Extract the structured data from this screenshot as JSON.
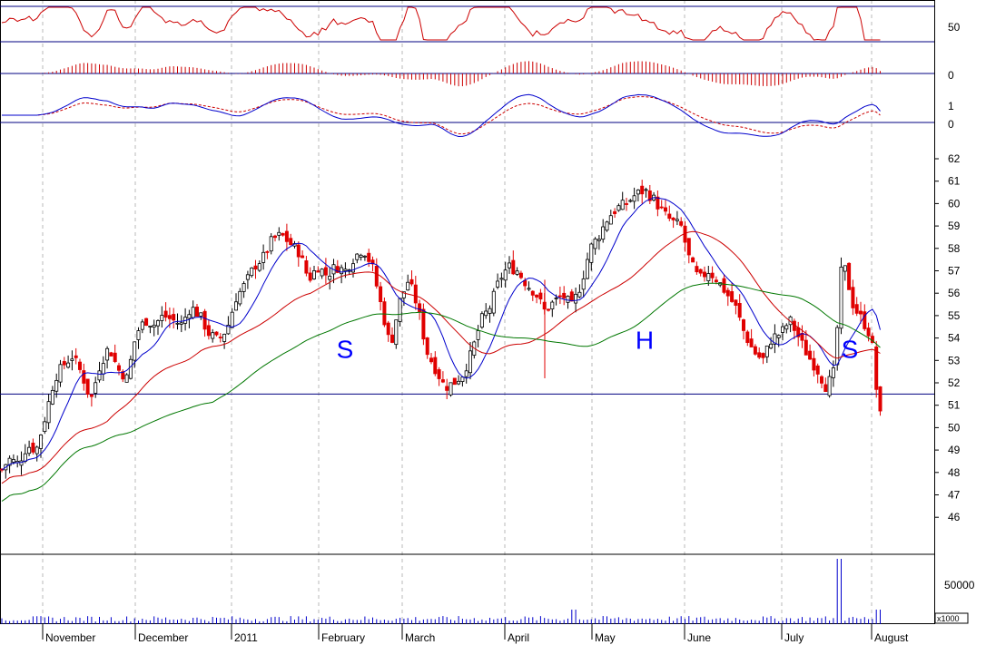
{
  "chart_data": {
    "type": "candlestick",
    "x_axis": {
      "months": [
        "November",
        "December",
        "2011",
        "February",
        "March",
        "April",
        "May",
        "June",
        "July",
        "August"
      ],
      "unit_label": "x1000"
    },
    "panels": [
      {
        "name": "rsi",
        "y_ticks": [
          "50"
        ]
      },
      {
        "name": "histogram",
        "y_ticks": [
          "0"
        ]
      },
      {
        "name": "oscillator",
        "y_ticks": [
          "1",
          "0"
        ]
      },
      {
        "name": "price",
        "y_ticks": [
          "62",
          "61",
          "60",
          "59",
          "58",
          "57",
          "56",
          "55",
          "54",
          "53",
          "52",
          "51",
          "50",
          "49",
          "48",
          "47",
          "46"
        ],
        "ylim": [
          45.3,
          62.4
        ],
        "neckline": 51.5
      },
      {
        "name": "volume",
        "y_ticks": [
          "50000"
        ]
      }
    ],
    "annotations": [
      {
        "text": "S",
        "x_month": "February",
        "y": 53.6
      },
      {
        "text": "H",
        "x_month": "May",
        "y": 54.0
      },
      {
        "text": "S",
        "x_month": "July",
        "y": 53.6
      }
    ],
    "price_path": [
      [
        0,
        48.0
      ],
      [
        10,
        48.6
      ],
      [
        20,
        48.4
      ],
      [
        30,
        49.2
      ],
      [
        40,
        49.0
      ],
      [
        50,
        50.5
      ],
      [
        60,
        52.2
      ],
      [
        70,
        52.8
      ],
      [
        80,
        53.2
      ],
      [
        90,
        52.4
      ],
      [
        100,
        51.2
      ],
      [
        110,
        52.8
      ],
      [
        120,
        53.6
      ],
      [
        130,
        52.6
      ],
      [
        140,
        52.2
      ],
      [
        150,
        54.2
      ],
      [
        160,
        54.8
      ],
      [
        170,
        54.6
      ],
      [
        180,
        55.0
      ],
      [
        190,
        54.8
      ],
      [
        200,
        54.6
      ],
      [
        210,
        55.4
      ],
      [
        220,
        55.0
      ],
      [
        230,
        54.2
      ],
      [
        240,
        53.9
      ],
      [
        250,
        54.4
      ],
      [
        260,
        55.8
      ],
      [
        270,
        56.4
      ],
      [
        280,
        57.2
      ],
      [
        290,
        57.6
      ],
      [
        300,
        58.4
      ],
      [
        310,
        58.6
      ],
      [
        320,
        58.2
      ],
      [
        330,
        57.8
      ],
      [
        340,
        56.6
      ],
      [
        350,
        57.2
      ],
      [
        360,
        56.8
      ],
      [
        370,
        57.2
      ],
      [
        380,
        57.0
      ],
      [
        390,
        57.6
      ],
      [
        400,
        58.0
      ],
      [
        410,
        57.2
      ],
      [
        420,
        55.4
      ],
      [
        430,
        53.6
      ],
      [
        440,
        55.6
      ],
      [
        450,
        56.6
      ],
      [
        460,
        55.4
      ],
      [
        470,
        53.4
      ],
      [
        480,
        52.6
      ],
      [
        490,
        51.8
      ],
      [
        500,
        52.0
      ],
      [
        510,
        52.4
      ],
      [
        520,
        53.4
      ],
      [
        530,
        54.8
      ],
      [
        540,
        55.4
      ],
      [
        550,
        56.6
      ],
      [
        560,
        57.2
      ],
      [
        570,
        57.0
      ],
      [
        580,
        56.4
      ],
      [
        590,
        56.0
      ],
      [
        600,
        55.2
      ],
      [
        610,
        55.6
      ],
      [
        620,
        55.9
      ],
      [
        630,
        55.4
      ],
      [
        640,
        56.4
      ],
      [
        650,
        58.0
      ],
      [
        660,
        58.6
      ],
      [
        670,
        59.4
      ],
      [
        680,
        59.8
      ],
      [
        690,
        60.0
      ],
      [
        700,
        60.4
      ],
      [
        710,
        60.6
      ],
      [
        720,
        60.2
      ],
      [
        730,
        59.6
      ],
      [
        740,
        59.2
      ],
      [
        750,
        59.0
      ],
      [
        760,
        57.4
      ],
      [
        770,
        56.6
      ],
      [
        780,
        57.0
      ],
      [
        790,
        56.6
      ],
      [
        800,
        56.0
      ],
      [
        810,
        55.4
      ],
      [
        820,
        54.2
      ],
      [
        830,
        53.4
      ],
      [
        840,
        53.0
      ],
      [
        850,
        54.0
      ],
      [
        860,
        54.2
      ],
      [
        870,
        54.8
      ],
      [
        880,
        54.0
      ],
      [
        890,
        53.2
      ],
      [
        900,
        52.6
      ],
      [
        910,
        51.8
      ],
      [
        920,
        52.6
      ],
      [
        925,
        56.8
      ],
      [
        930,
        57.2
      ],
      [
        940,
        55.4
      ],
      [
        950,
        54.8
      ],
      [
        960,
        54.0
      ],
      [
        965,
        51.8
      ],
      [
        970,
        50.4
      ]
    ]
  }
}
